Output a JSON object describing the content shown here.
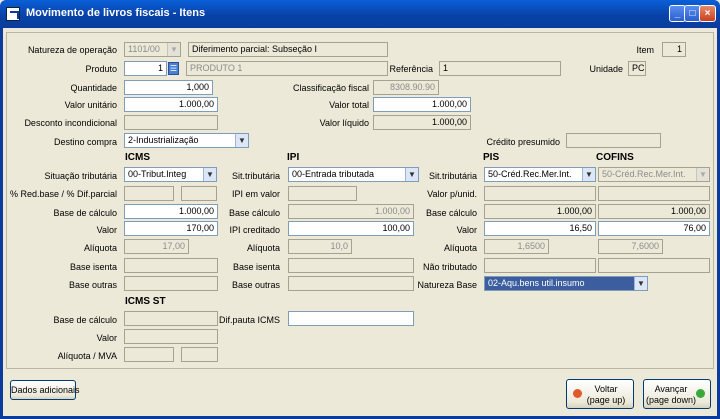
{
  "window": {
    "title": "Movimento de livros fiscais - Itens"
  },
  "header": {
    "natureza_label": "Natureza de operação",
    "natureza_code": "1101/00",
    "natureza_desc": "Diferimento parcial: Subseção I",
    "item_label": "Item",
    "item_value": "1",
    "produto_label": "Produto",
    "produto_code": "1",
    "produto_desc": "PRODUTO 1",
    "referencia_label": "Referência",
    "referencia_value": "1",
    "unidade_label": "Unidade",
    "unidade_value": "PC",
    "quantidade_label": "Quantidade",
    "quantidade_value": "1,000",
    "classificacao_label": "Classificação fiscal",
    "classificacao_value": "8308.90.90",
    "valor_unitario_label": "Valor unitário",
    "valor_unitario_value": "1.000,00",
    "valor_total_label": "Valor total",
    "valor_total_value": "1.000,00",
    "desconto_label": "Desconto incondicional",
    "desconto_value": "",
    "valor_liquido_label": "Valor líquido",
    "valor_liquido_value": "1.000,00",
    "destino_label": "Destino compra",
    "destino_value": "2-Industrialização",
    "credito_label": "Crédito presumido",
    "credito_value": ""
  },
  "icms": {
    "title": "ICMS",
    "situacao_label": "Situação tributária",
    "situacao_value": "00-Tribut.Integ",
    "red_label": "% Red.base / % Dif.parcial",
    "red_value1": "",
    "red_value2": "",
    "base_label": "Base de cálculo",
    "base_value": "1.000,00",
    "valor_label": "Valor",
    "valor_value": "170,00",
    "aliquota_label": "Alíquota",
    "aliquota_value": "17,00",
    "isenta_label": "Base isenta",
    "isenta_value": "",
    "outras_label": "Base outras",
    "outras_value": ""
  },
  "ipi": {
    "title": "IPI",
    "sit_label": "Sit.tributária",
    "sit_value": "00-Entrada tributada",
    "em_valor_label": "IPI em valor",
    "em_valor_value": "",
    "base_label": "Base cálculo",
    "base_value": "1.000,00",
    "creditado_label": "IPI creditado",
    "creditado_value": "100,00",
    "aliquota_label": "Alíquota",
    "aliquota_value": "10,0",
    "isenta_label": "Base isenta",
    "isenta_value": "",
    "outras_label": "Base outras",
    "outras_value": ""
  },
  "pis": {
    "title": "PIS",
    "sit_label": "Sit.tributária",
    "sit_value": "50-Créd.Rec.Mer.Int.",
    "punid_label": "Valor p/unid.",
    "punid_value": "",
    "base_label": "Base cálculo",
    "base_value": "1.000,00",
    "valor_label": "Valor",
    "valor_value": "16,50",
    "aliquota_label": "Alíquota",
    "aliquota_value": "1,6500",
    "nao_trib_label": "Não tributado",
    "nao_trib_value": "",
    "natureza_label": "Natureza Base",
    "natureza_value": "02-Aqu.bens util.insumo"
  },
  "cofins": {
    "title": "COFINS",
    "sit_value": "50-Créd.Rec.Mer.Int.",
    "punid_value": "",
    "base_value": "1.000,00",
    "valor_value": "76,00",
    "aliquota_value": "7,6000",
    "nao_trib_value": ""
  },
  "icms_st": {
    "title": "ICMS ST",
    "base_label": "Base de cálculo",
    "base_value": "",
    "valor_label": "Valor",
    "valor_value": "",
    "aliquota_label": "Alíquota / MVA",
    "aliquota_value": "",
    "mva_value": "",
    "dif_label": "Dif.pauta ICMS",
    "dif_value": ""
  },
  "footer": {
    "dados_label": "Dados adicionais",
    "voltar_label": "Voltar",
    "voltar_hint": "(page up)",
    "avancar_label": "Avançar",
    "avancar_hint": "(page down)"
  },
  "icons": {
    "app": "app-icon",
    "minimize": "minimize-icon",
    "maximize": "maximize-icon",
    "close": "close-icon",
    "lookup": "lookup-icon",
    "back": "back-arrow-icon",
    "forward": "forward-arrow-icon"
  },
  "colors": {
    "titlebar": "#0a3c9e",
    "back_icon": "#e05a2a",
    "forward_icon": "#3aa83a"
  }
}
